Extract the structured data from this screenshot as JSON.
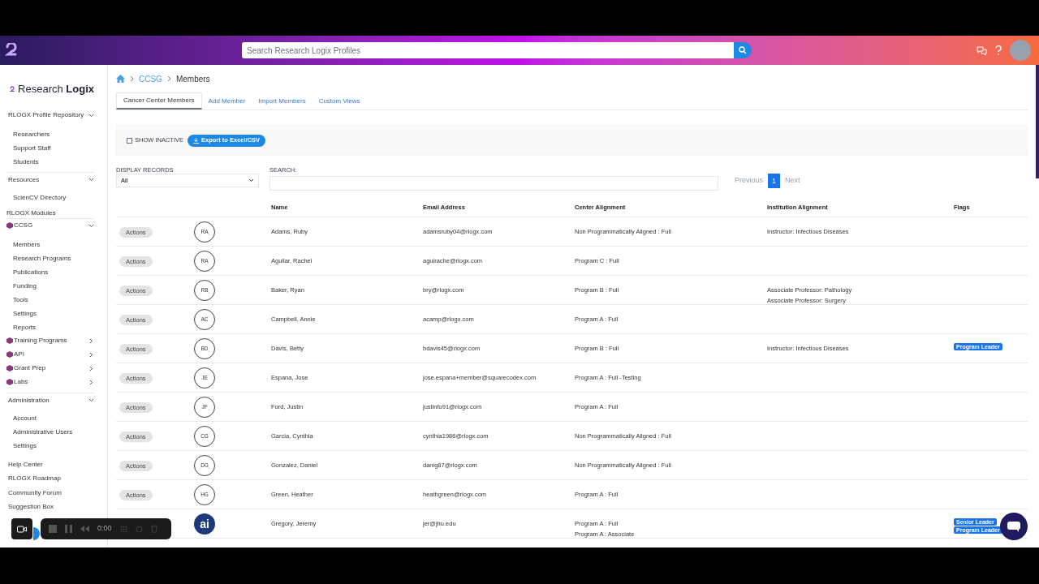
{
  "header": {
    "search": {
      "placeholder": "Search Research Logix Profiles"
    }
  },
  "sidebar": {
    "brand": {
      "name_light": "Research ",
      "name_bold": "Logix"
    },
    "items": [
      {
        "kind": "section",
        "label": "RLOGX Profile Repository",
        "expanded": true
      },
      {
        "kind": "link",
        "label": "Researchers"
      },
      {
        "kind": "link",
        "label": "Support Staff"
      },
      {
        "kind": "link",
        "label": "Students"
      },
      {
        "kind": "section",
        "label": "Resources",
        "expanded": true
      },
      {
        "kind": "link",
        "label": "ScienCV Directory"
      },
      {
        "kind": "heading",
        "label": "RLOGX Modules"
      },
      {
        "kind": "module",
        "label": "CCSG",
        "expanded": true
      },
      {
        "kind": "link",
        "label": "Members"
      },
      {
        "kind": "link",
        "label": "Research Programs"
      },
      {
        "kind": "link",
        "label": "Publications"
      },
      {
        "kind": "link",
        "label": "Funding"
      },
      {
        "kind": "link",
        "label": "Tools"
      },
      {
        "kind": "link",
        "label": "Settings"
      },
      {
        "kind": "link",
        "label": "Reports"
      },
      {
        "kind": "module",
        "label": "Training Programs",
        "expanded": false
      },
      {
        "kind": "module",
        "label": "API",
        "expanded": false
      },
      {
        "kind": "module",
        "label": "Grant Prep",
        "expanded": false
      },
      {
        "kind": "module",
        "label": "Labs",
        "expanded": false
      },
      {
        "kind": "section",
        "label": "Administration",
        "expanded": true
      },
      {
        "kind": "link",
        "label": "Account"
      },
      {
        "kind": "link",
        "label": "Administrative Users"
      },
      {
        "kind": "link",
        "label": "Settings"
      },
      {
        "kind": "footer",
        "label": "Help Center"
      },
      {
        "kind": "footer",
        "label": "RLOGX Roadmap"
      },
      {
        "kind": "footer",
        "label": "Community Forum"
      },
      {
        "kind": "footer",
        "label": "Suggestion Box"
      }
    ]
  },
  "breadcrumb": [
    "CCSG",
    "Members"
  ],
  "tabs": [
    {
      "label": "Cancer Center Members",
      "selected": true
    },
    {
      "label": "Add Member",
      "selected": false
    },
    {
      "label": "Import Members",
      "selected": false
    },
    {
      "label": "Custom Views",
      "selected": false
    }
  ],
  "toolbar": {
    "show_inactive": {
      "label": "SHOW INACTIVE",
      "checked": false
    },
    "export_button": "Export to Excel/CSV"
  },
  "display_records": {
    "label": "DISPLAY RECORDS",
    "value": "All"
  },
  "search": {
    "label": "SEARCH:"
  },
  "pagination": {
    "previous": "Previous",
    "pages": [
      {
        "label": "1",
        "selected": true
      }
    ],
    "next": "Next"
  },
  "table": {
    "columns": [
      "Name",
      "Email Address",
      "Center Alignment",
      "Institution Alignment",
      "Flags"
    ],
    "rows": [
      {
        "action": "Actions",
        "avatar": {
          "kind": "initials",
          "text": "RA"
        },
        "name": "Adams, Ruby",
        "email": "adamsruby04@rlogx.com",
        "center": [
          "Non Programmatically Aligned : Full"
        ],
        "institution": [
          "Instructor: Infectious Diseases"
        ],
        "flags": []
      },
      {
        "action": "Actions",
        "avatar": {
          "kind": "initials",
          "text": "RA"
        },
        "name": "Aguilar, Rachel",
        "email": "aguirache@rlogx.com",
        "center": [
          "Program C : Full"
        ],
        "institution": [],
        "flags": []
      },
      {
        "action": "Actions",
        "avatar": {
          "kind": "initials",
          "text": "RB"
        },
        "name": "Baker, Ryan",
        "email": "bry@rlogx.com",
        "center": [
          "Program B : Full"
        ],
        "institution": [
          "Associate Professor: Pathology",
          "Associate Professor: Surgery"
        ],
        "flags": []
      },
      {
        "action": "Actions",
        "avatar": {
          "kind": "initials",
          "text": "AC"
        },
        "name": "Campbell, Annie",
        "email": "acamp@rlogx.com",
        "center": [
          "Program A : Full"
        ],
        "institution": [],
        "flags": []
      },
      {
        "action": "Actions",
        "avatar": {
          "kind": "initials",
          "text": "BD"
        },
        "name": "Davis, Betty",
        "email": "bdavis45@rlogx.com",
        "center": [
          "Program B : Full"
        ],
        "institution": [
          "Instructor: Infectious Diseases"
        ],
        "flags": [
          "Program Leader"
        ]
      },
      {
        "action": "Actions",
        "avatar": {
          "kind": "initials",
          "text": "JE"
        },
        "name": "Espana, Jose",
        "email": "jose.espana+member@squarecodex.com",
        "center": [
          "Program A : Full -Testing"
        ],
        "institution": [],
        "flags": []
      },
      {
        "action": "Actions",
        "avatar": {
          "kind": "initials",
          "text": "JF"
        },
        "name": "Ford, Justin",
        "email": "justinfo91@rlogx.com",
        "center": [
          "Program A : Full"
        ],
        "institution": [],
        "flags": []
      },
      {
        "action": "Actions",
        "avatar": {
          "kind": "initials",
          "text": "CG"
        },
        "name": "Garcia, Cynthia",
        "email": "cynthia1986@rlogx.com",
        "center": [
          "Non Programmatically Aligned : Full"
        ],
        "institution": [],
        "flags": []
      },
      {
        "action": "Actions",
        "avatar": {
          "kind": "initials",
          "text": "DG"
        },
        "name": "Gonzalez, Daniel",
        "email": "danig87@rlogx.com",
        "center": [
          "Non Programmatically Aligned : Full"
        ],
        "institution": [],
        "flags": []
      },
      {
        "action": "Actions",
        "avatar": {
          "kind": "initials",
          "text": "HG"
        },
        "name": "Green, Heather",
        "email": "heathgreen@rlogx.com",
        "center": [
          "Program A : Full"
        ],
        "institution": [],
        "flags": []
      },
      {
        "avatar": {
          "kind": "logo",
          "text": "ai"
        },
        "name": "Gregory, Jeremy",
        "email": "jer@jhu.edu",
        "center": [
          "Program A : Full",
          "Program A : Associate"
        ],
        "institution": [],
        "flags": [
          "Senior Leader",
          "Program Leader"
        ]
      }
    ]
  },
  "recorder": {
    "time": "0:00"
  }
}
